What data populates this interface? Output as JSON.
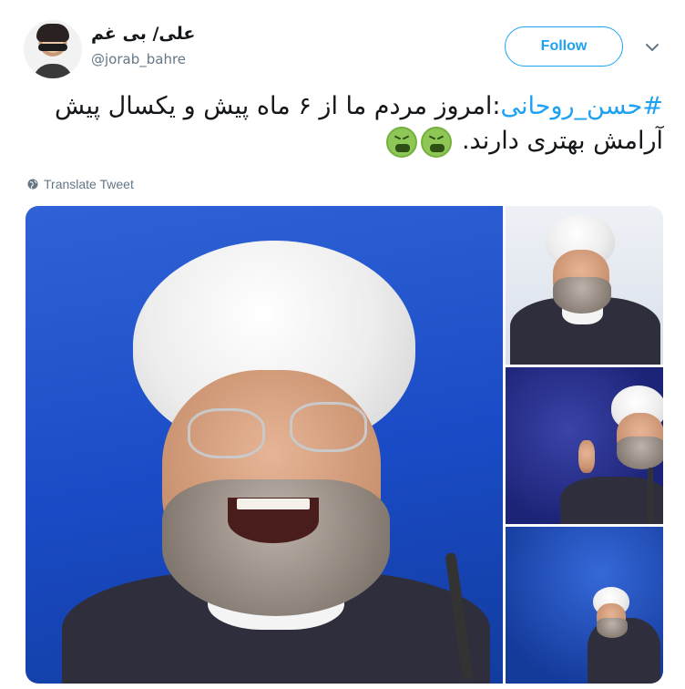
{
  "user": {
    "display_name": "علی/ بی غم",
    "handle": "@jorab_bahre"
  },
  "actions": {
    "follow_label": "Follow"
  },
  "tweet": {
    "hashtag": "#حسن_روحانی",
    "text": ":امروز مردم ما از ۶ ماه پیش و یکسال پیش آرامش بهتری دارند.",
    "emoji": [
      "nauseated-face",
      "nauseated-face"
    ]
  },
  "translate_label": "Translate Tweet",
  "colors": {
    "accent": "#1da1f2",
    "secondary_text": "#657786"
  },
  "media": {
    "count": 4
  }
}
